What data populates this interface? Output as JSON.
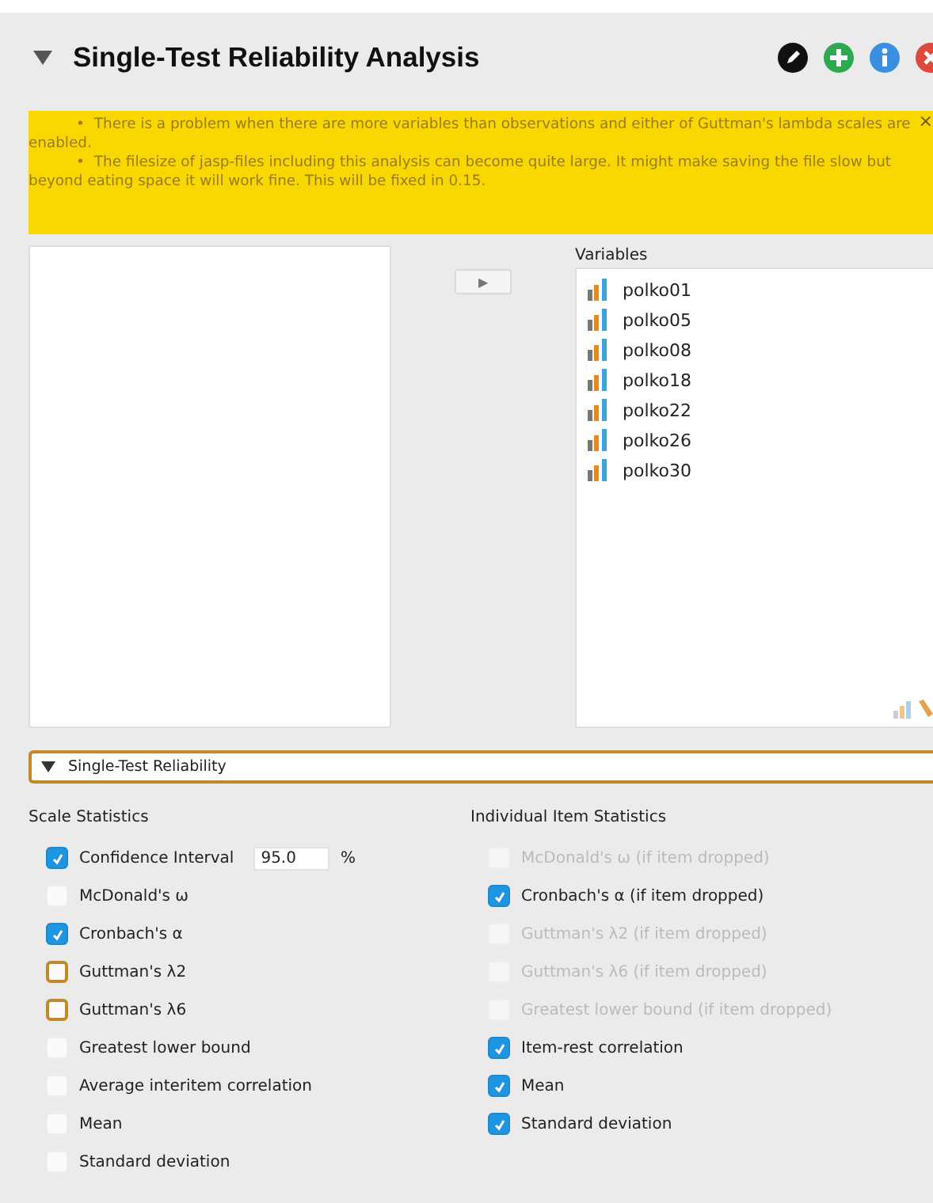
{
  "header": {
    "title": "Single-Test Reliability Analysis",
    "expanded": true
  },
  "warning": {
    "bullet": "•",
    "items": [
      "There is a problem when there are more variables than observations and either of Guttman's lambda scales are enabled.",
      "The filesize of jasp-files including this analysis can become quite large. It might make saving the file slow but beyond eating space it will work fine. This will be fixed in 0.15."
    ],
    "close": "×"
  },
  "move_button": "▶",
  "variables": {
    "label": "Variables",
    "items": [
      "polko01",
      "polko05",
      "polko08",
      "polko18",
      "polko22",
      "polko26",
      "polko30"
    ]
  },
  "section": {
    "title": "Single-Test Reliability",
    "expanded": true
  },
  "scale_statistics": {
    "heading": "Scale Statistics",
    "options": [
      {
        "kind": "field",
        "label": "Confidence Interval",
        "checked": true,
        "disabled": false,
        "highlighted": false,
        "value": "95.0",
        "unit": "%"
      },
      {
        "kind": "check",
        "label": "McDonald's ω",
        "checked": false,
        "disabled": false,
        "highlighted": false
      },
      {
        "kind": "check",
        "label": "Cronbach's α",
        "checked": true,
        "disabled": false,
        "highlighted": false
      },
      {
        "kind": "check",
        "label": "Guttman's λ2",
        "checked": false,
        "disabled": false,
        "highlighted": true
      },
      {
        "kind": "check",
        "label": "Guttman's λ6",
        "checked": false,
        "disabled": false,
        "highlighted": true
      },
      {
        "kind": "check",
        "label": "Greatest lower bound",
        "checked": false,
        "disabled": false,
        "highlighted": false
      },
      {
        "kind": "check",
        "label": "Average interitem correlation",
        "checked": false,
        "disabled": false,
        "highlighted": false
      },
      {
        "kind": "check",
        "label": "Mean",
        "checked": false,
        "disabled": false,
        "highlighted": false
      },
      {
        "kind": "check",
        "label": "Standard deviation",
        "checked": false,
        "disabled": false,
        "highlighted": false
      }
    ]
  },
  "item_statistics": {
    "heading": "Individual Item Statistics",
    "options": [
      {
        "kind": "check",
        "label": "McDonald's ω  (if item dropped)",
        "checked": false,
        "disabled": true,
        "highlighted": false
      },
      {
        "kind": "check",
        "label": "Cronbach's α (if item dropped)",
        "checked": true,
        "disabled": false,
        "highlighted": false
      },
      {
        "kind": "check",
        "label": "Guttman's λ2 (if item dropped)",
        "checked": false,
        "disabled": true,
        "highlighted": false
      },
      {
        "kind": "check",
        "label": "Guttman's λ6 (if item dropped)",
        "checked": false,
        "disabled": true,
        "highlighted": false
      },
      {
        "kind": "check",
        "label": "Greatest lower bound (if item dropped)",
        "checked": false,
        "disabled": true,
        "highlighted": false
      },
      {
        "kind": "check",
        "label": "Item-rest correlation",
        "checked": true,
        "disabled": false,
        "highlighted": false
      },
      {
        "kind": "check",
        "label": "Mean",
        "checked": true,
        "disabled": false,
        "highlighted": false
      },
      {
        "kind": "check",
        "label": "Standard deviation",
        "checked": true,
        "disabled": false,
        "highlighted": false
      }
    ]
  }
}
